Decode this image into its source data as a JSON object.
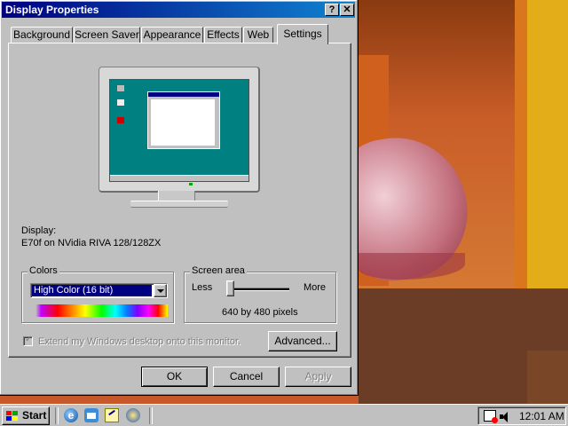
{
  "window": {
    "title": "Display Properties",
    "help_btn": "?",
    "close_btn": "✕"
  },
  "tabs": [
    {
      "label": "Background"
    },
    {
      "label": "Screen Saver"
    },
    {
      "label": "Appearance"
    },
    {
      "label": "Effects"
    },
    {
      "label": "Web"
    },
    {
      "label": "Settings",
      "active": true
    }
  ],
  "display": {
    "label": "Display:",
    "value": "E70f on NVidia RIVA 128/128ZX"
  },
  "colors": {
    "group_label": "Colors",
    "selected": "High Color (16 bit)"
  },
  "screen_area": {
    "group_label": "Screen area",
    "less": "Less",
    "more": "More",
    "value_text": "640 by 480 pixels",
    "slider_level": 0
  },
  "extend": {
    "label": "Extend my Windows desktop onto this monitor.",
    "checked": true,
    "enabled": false
  },
  "buttons": {
    "advanced": "Advanced...",
    "ok": "OK",
    "cancel": "Cancel",
    "apply": "Apply"
  },
  "taskbar": {
    "start": "Start",
    "clock": "12:01 AM"
  },
  "icons": [
    "help-icon",
    "close-icon",
    "monitor-preview",
    "dropdown-arrow-icon",
    "windows-logo-icon",
    "ie-icon",
    "outlook-express-icon",
    "show-desktop-icon",
    "channels-icon",
    "scheduler-icon",
    "volume-icon"
  ],
  "colors_palette": {
    "title_start": "#000080",
    "title_end": "#1084d0",
    "face": "#c0c0c0",
    "preview_desktop": "#008080",
    "select_highlight": "#000080"
  }
}
